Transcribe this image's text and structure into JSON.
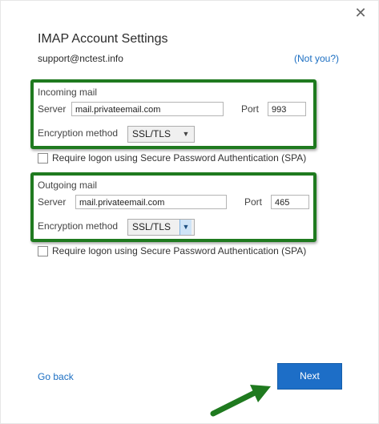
{
  "window": {
    "close_glyph": "✕"
  },
  "header": {
    "title": "IMAP Account Settings",
    "email": "support@nctest.info",
    "not_you": "(Not you?)"
  },
  "incoming": {
    "section_label": "Incoming mail",
    "server_label": "Server",
    "server_value": "mail.privateemail.com",
    "port_label": "Port",
    "port_value": "993",
    "encryption_label": "Encryption method",
    "encryption_value": "SSL/TLS",
    "spa_label": "Require logon using Secure Password Authentication (SPA)",
    "spa_checked": false
  },
  "outgoing": {
    "section_label": "Outgoing mail",
    "server_label": "Server",
    "server_value": "mail.privateemail.com",
    "port_label": "Port",
    "port_value": "465",
    "encryption_label": "Encryption method",
    "encryption_value": "SSL/TLS",
    "spa_label": "Require logon using Secure Password Authentication (SPA)",
    "spa_checked": false
  },
  "footer": {
    "back_label": "Go back",
    "next_label": "Next"
  },
  "colors": {
    "accent_blue": "#1d6ec7",
    "link_blue": "#1b6ec2",
    "highlight_green": "#1f7a1f"
  },
  "icons": {
    "close": "close-icon",
    "dropdown": "chevron-down-icon",
    "pointer": "green-arrow-icon"
  }
}
